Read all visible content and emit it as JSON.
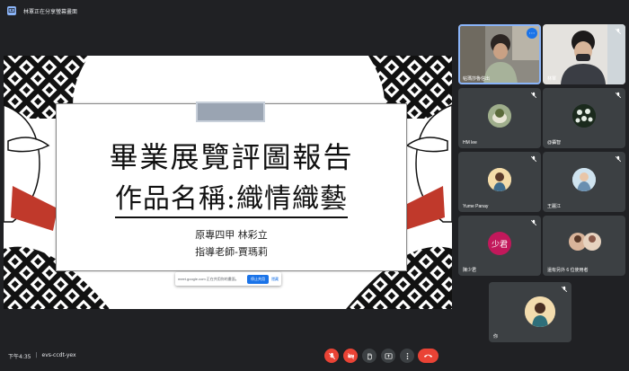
{
  "topbar": {
    "text": "林覃正在分享螢幕畫面",
    "icon": "present-screen-icon"
  },
  "slide": {
    "title": "畢業展覽評圖報告",
    "subtitle": "作品名稱:織情織藝",
    "author": "原專四甲 林彩立",
    "advisor": "指導老師-賈瑪莉"
  },
  "share_bar": {
    "text": "meet.google.com 正在共用你的畫面。",
    "stop_label": "停止共用",
    "hide_label": "隱藏"
  },
  "participants": [
    {
      "name": "帖瑪莎魯信出",
      "type": "video"
    },
    {
      "name": "林覃",
      "type": "video"
    },
    {
      "name": "HM lee",
      "type": "avatar"
    },
    {
      "name": "@攝智",
      "type": "avatar"
    },
    {
      "name": "Yume Panay",
      "type": "avatar"
    },
    {
      "name": "王麗江",
      "type": "avatar"
    },
    {
      "name": "陳少君",
      "type": "initials",
      "initials": "少君",
      "color": "#c2185b"
    },
    {
      "name": "還有另外 6 位使用者",
      "type": "group"
    },
    {
      "name": "你",
      "type": "avatar"
    }
  ],
  "bottom": {
    "time": "下午4:35",
    "meeting_code": "evs-ccdt-yex"
  },
  "controls": [
    "mic-off-icon",
    "camera-off-icon",
    "raise-hand-icon",
    "present-icon",
    "more-options-icon",
    "end-call-icon"
  ]
}
